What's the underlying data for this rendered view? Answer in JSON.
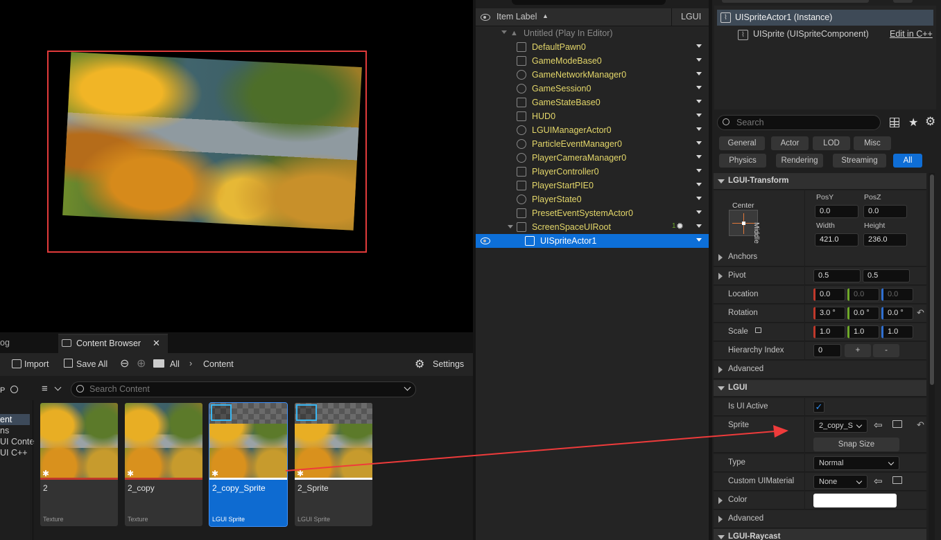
{
  "outliner": {
    "header_label": "Item Label",
    "header_sort": "▲",
    "header_col": "LGUI",
    "world": "Untitled (Play In Editor)",
    "items": [
      {
        "label": "DefaultPawn0",
        "icon": "pawn-icon"
      },
      {
        "label": "GameModeBase0",
        "icon": "gamemode-icon"
      },
      {
        "label": "GameNetworkManager0",
        "icon": "actor-sphere-icon"
      },
      {
        "label": "GameSession0",
        "icon": "actor-sphere-icon"
      },
      {
        "label": "GameStateBase0",
        "icon": "gamestate-icon"
      },
      {
        "label": "HUD0",
        "icon": "hud-icon"
      },
      {
        "label": "LGUIManagerActor0",
        "icon": "actor-sphere-icon"
      },
      {
        "label": "ParticleEventManager0",
        "icon": "actor-sphere-icon"
      },
      {
        "label": "PlayerCameraManager0",
        "icon": "actor-sphere-icon"
      },
      {
        "label": "PlayerController0",
        "icon": "gamepad-icon"
      },
      {
        "label": "PlayerStartPIE0",
        "icon": "flag-icon"
      },
      {
        "label": "PlayerState0",
        "icon": "actor-sphere-icon"
      },
      {
        "label": "PresetEventSystemActor0",
        "icon": "event-system-icon"
      },
      {
        "label": "ScreenSpaceUIRoot",
        "icon": "ui-root-icon"
      },
      {
        "label": "UISpriteActor1",
        "icon": "sprite-icon"
      }
    ],
    "ui_root_badge": "1"
  },
  "details": {
    "instance_label": "UISpriteActor1 (Instance)",
    "component_label": "UISprite (UISpriteComponent)",
    "edit_link": "Edit in C++",
    "search_placeholder": "Search",
    "filter_row1": [
      "General",
      "Actor",
      "LOD",
      "Misc"
    ],
    "filter_row2": [
      "Physics",
      "Rendering",
      "Streaming",
      "All"
    ],
    "sections": {
      "transform": "LGUI-Transform",
      "lgui": "LGUI",
      "raycast": "LGUI-Raycast"
    },
    "anchor": {
      "h": "Center",
      "v": "Middle"
    },
    "fields": {
      "posy_label": "PosY",
      "posz_label": "PosZ",
      "posy": "0.0",
      "posz": "0.0",
      "width_label": "Width",
      "height_label": "Height",
      "width": "421.0",
      "height": "236.0"
    },
    "props": {
      "anchors": "Anchors",
      "pivot": "Pivot",
      "pivot_x": "0.5",
      "pivot_y": "0.5",
      "location": "Location",
      "loc": [
        "0.0",
        "0.0",
        "0.0"
      ],
      "rotation": "Rotation",
      "rot": [
        "3.0 °",
        "0.0 °",
        "0.0 °"
      ],
      "scale": "Scale",
      "scl": [
        "1.0",
        "1.0",
        "1.0"
      ],
      "hierarchy": "Hierarchy Index",
      "hierarchy_val": "0",
      "plus": "+",
      "minus": "-",
      "advanced": "Advanced",
      "is_ui_active": "Is UI Active",
      "sprite": "Sprite",
      "sprite_val": "2_copy_S",
      "snap_size": "Snap Size",
      "type": "Type",
      "type_val": "Normal",
      "custom_mat": "Custom UIMaterial",
      "custom_mat_val": "None",
      "color": "Color",
      "color_val": "#ffffff",
      "advanced2": "Advanced"
    }
  },
  "content_browser": {
    "tab_partial": "og",
    "tab_label": "Content Browser",
    "import": "Import",
    "save_all": "Save All",
    "crumb_all": "All",
    "crumb_content": "Content",
    "settings": "Settings",
    "search_placeholder": "Search Content",
    "left_partial": [
      "P",
      "ent",
      "ns",
      "UI Conte",
      "UI C++"
    ],
    "assets": [
      {
        "name": "2",
        "type": "Texture",
        "bar": "#c0392b",
        "selected": false,
        "sprite": false
      },
      {
        "name": "2_copy",
        "type": "Texture",
        "bar": "#c0392b",
        "selected": false,
        "sprite": false
      },
      {
        "name": "2_copy_Sprite",
        "type": "LGUI Sprite",
        "bar": "#ffffff",
        "selected": true,
        "sprite": true
      },
      {
        "name": "2_Sprite",
        "type": "LGUI Sprite",
        "bar": "#ffffff",
        "selected": false,
        "sprite": true
      }
    ]
  },
  "colors": {
    "accent": "#0e6bd1",
    "selection_frame": "#e23b3b",
    "arrow": "#ef3b3b"
  }
}
